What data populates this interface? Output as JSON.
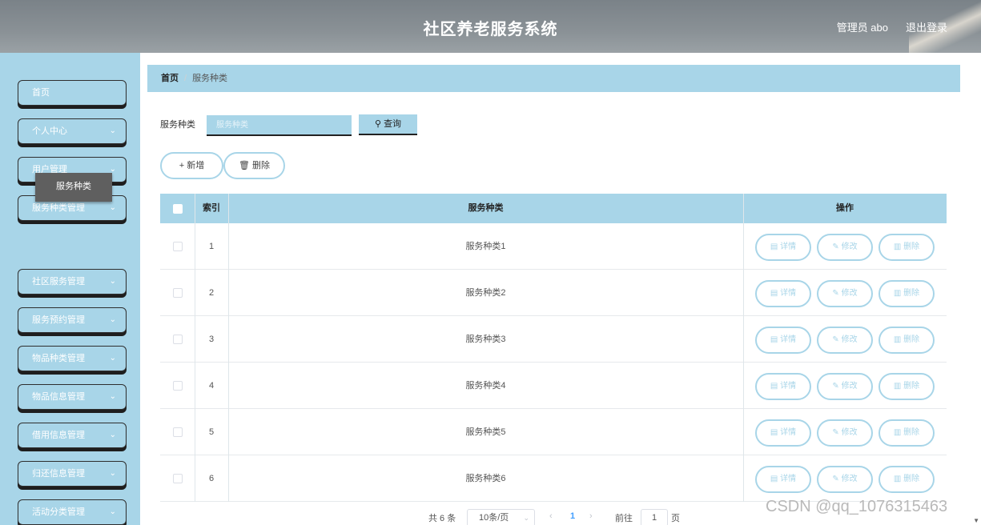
{
  "header": {
    "title": "社区养老服务系统",
    "admin_label": "管理员 abo",
    "logout_label": "退出登录"
  },
  "sidebar": {
    "items": [
      {
        "label": "首页",
        "has_chevron": false
      },
      {
        "label": "个人中心",
        "has_chevron": true
      },
      {
        "label": "用户管理",
        "has_chevron": true
      },
      {
        "label": "服务种类管理",
        "has_chevron": true
      },
      {
        "label": "社区服务管理",
        "has_chevron": true
      },
      {
        "label": "服务预约管理",
        "has_chevron": true
      },
      {
        "label": "物品种类管理",
        "has_chevron": true
      },
      {
        "label": "物品信息管理",
        "has_chevron": true
      },
      {
        "label": "借用信息管理",
        "has_chevron": true
      },
      {
        "label": "归还信息管理",
        "has_chevron": true
      },
      {
        "label": "活动分类管理",
        "has_chevron": true
      }
    ],
    "active_submenu": "服务种类",
    "chevron_icon": "chevron-down-icon"
  },
  "breadcrumb": {
    "home": "首页",
    "separator": "/",
    "current": "服务种类"
  },
  "search": {
    "label": "服务种类",
    "placeholder": "服务种类",
    "button_label": "查询",
    "button_icon": "search-icon"
  },
  "actions": {
    "add_label": "新增",
    "delete_label": "删除"
  },
  "table": {
    "headers": {
      "index": "索引",
      "category": "服务种类",
      "operations": "操作"
    },
    "rows": [
      {
        "index": "1",
        "category": "服务种类1"
      },
      {
        "index": "2",
        "category": "服务种类2"
      },
      {
        "index": "3",
        "category": "服务种类3"
      },
      {
        "index": "4",
        "category": "服务种类4"
      },
      {
        "index": "5",
        "category": "服务种类5"
      },
      {
        "index": "6",
        "category": "服务种类6"
      }
    ],
    "row_actions": {
      "detail": "详情",
      "edit": "修改",
      "delete": "删除"
    }
  },
  "pagination": {
    "total": "共 6 条",
    "page_size": "10条/页",
    "current_page": "1",
    "goto_label": "前往",
    "goto_value": "1",
    "page_suffix": "页"
  },
  "watermark": "CSDN @qq_1076315463",
  "colors": {
    "accent": "#a8d5e8",
    "header": "#868d92",
    "submenu": "#5f5f5f"
  }
}
